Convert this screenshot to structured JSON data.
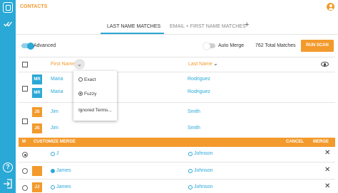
{
  "app": {
    "title": "CONTACTS"
  },
  "tabs": [
    {
      "label": "LAST NAME MATCHES",
      "active": true
    },
    {
      "label": "EMAIL + FIRST NAME MATCHES",
      "active": false
    }
  ],
  "controls": {
    "advanced_label": "Advanced",
    "advanced_on": true,
    "auto_merge_label": "Auto Merge",
    "auto_merge_on": false,
    "total_matches": "762 Total Matches",
    "run_scan_label": "RUN SCAN"
  },
  "table": {
    "headers": {
      "first_name": "First Name",
      "last_name": "Last Name"
    },
    "rows": [
      {
        "initials": "MR",
        "first": "Maria",
        "last": "Rodriguez",
        "color": "#2aa8d6"
      },
      {
        "initials": "MR",
        "first": "Maria",
        "last": "Rodriguez",
        "color": "#2aa8d6"
      },
      {
        "initials": "JS",
        "first": "Jim",
        "last": "Smith",
        "color": "#f39a2c"
      },
      {
        "initials": "JS",
        "first": "Jim",
        "last": "Smith",
        "color": "#f39a2c"
      }
    ]
  },
  "dropdown": {
    "options": [
      {
        "label": "Exact",
        "selected": false
      },
      {
        "label": "Fuzzy",
        "selected": true
      }
    ],
    "ignored_terms": "Ignored Terms..."
  },
  "merge_bar": {
    "m_label": "M",
    "title": "CUSTOMIZE MERGE",
    "cancel_label": "CANCEL",
    "merge_label": "MERGE"
  },
  "merge_rows": [
    {
      "first": "J",
      "last": "Johnson",
      "row_selected": true,
      "first_selected": false
    },
    {
      "first": "James",
      "last": "Johnson",
      "row_selected": false,
      "first_selected": true
    },
    {
      "initials": "JJ",
      "first": "James",
      "last": "Johnson",
      "row_selected": false,
      "first_selected": false
    }
  ],
  "colors": {
    "brand_blue": "#2aa8d6",
    "accent_orange": "#f39a2c"
  },
  "icons": [
    "logo-icon",
    "checkmark-icon",
    "help-icon",
    "exit-icon",
    "user-icon",
    "plus-icon",
    "chevron-down-icon",
    "eye-icon",
    "close-icon"
  ]
}
